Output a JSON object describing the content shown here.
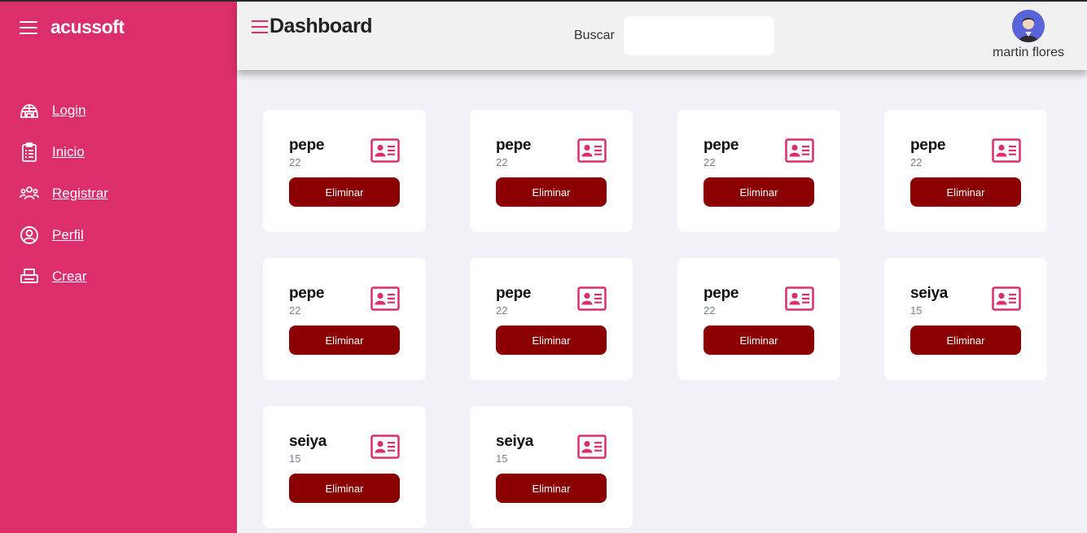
{
  "app": {
    "brand": "acussoft"
  },
  "sidebar": {
    "items": [
      {
        "label": "Login",
        "icon": "igloo-icon"
      },
      {
        "label": "Inicio",
        "icon": "clipboard-list-icon"
      },
      {
        "label": "Registrar",
        "icon": "users-icon"
      },
      {
        "label": "Perfil",
        "icon": "user-circle-icon"
      },
      {
        "label": "Crear",
        "icon": "printer-icon"
      }
    ]
  },
  "header": {
    "title": "Dashboard",
    "search_label": "Buscar",
    "search_value": "",
    "user_name": "martin flores"
  },
  "cards": [
    {
      "name": "pepe",
      "age": "22",
      "button": "Eliminar"
    },
    {
      "name": "pepe",
      "age": "22",
      "button": "Eliminar"
    },
    {
      "name": "pepe",
      "age": "22",
      "button": "Eliminar"
    },
    {
      "name": "pepe",
      "age": "22",
      "button": "Eliminar"
    },
    {
      "name": "pepe",
      "age": "22",
      "button": "Eliminar"
    },
    {
      "name": "pepe",
      "age": "22",
      "button": "Eliminar"
    },
    {
      "name": "pepe",
      "age": "22",
      "button": "Eliminar"
    },
    {
      "name": "seiya",
      "age": "15",
      "button": "Eliminar"
    },
    {
      "name": "seiya",
      "age": "15",
      "button": "Eliminar"
    },
    {
      "name": "seiya",
      "age": "15",
      "button": "Eliminar"
    }
  ],
  "colors": {
    "sidebar": "#dc2e6c",
    "accent": "#dc2e6c",
    "button": "#8b0000",
    "background": "#f0f2f7",
    "header": "#f1f1f1"
  }
}
